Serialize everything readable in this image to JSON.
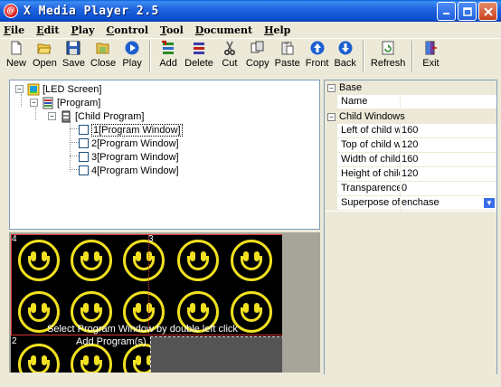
{
  "window": {
    "title": "X Media Player 2.5",
    "icon_letter": "@"
  },
  "menu": [
    {
      "label": "File",
      "u": "F",
      "rest": "ile"
    },
    {
      "label": "Edit",
      "u": "E",
      "rest": "dit"
    },
    {
      "label": "Play",
      "u": "P",
      "rest": "lay"
    },
    {
      "label": "Control",
      "u": "C",
      "rest": "ontrol"
    },
    {
      "label": "Tool",
      "u": "T",
      "rest": "ool"
    },
    {
      "label": "Document",
      "u": "D",
      "rest": "ocument"
    },
    {
      "label": "Help",
      "u": "H",
      "rest": "elp"
    }
  ],
  "toolbar": {
    "new": "New",
    "open": "Open",
    "save": "Save",
    "close": "Close",
    "play": "Play",
    "add": "Add",
    "delete": "Delete",
    "cut": "Cut",
    "copy": "Copy",
    "paste": "Paste",
    "front": "Front",
    "back": "Back",
    "refresh": "Refresh",
    "exit": "Exit"
  },
  "tree": {
    "root": "[LED Screen]",
    "program": "[Program]",
    "child": "[Child Program]",
    "windows": [
      "1[Program Window]",
      "2[Program Window]",
      "3[Program Window]",
      "4[Program Window]"
    ]
  },
  "preview": {
    "hint": "Select Program Window by double left click",
    "add_program": "Add Program(s)",
    "corner_4": "4",
    "corner_3": "3",
    "corner_2": "2"
  },
  "properties": {
    "base_label": "Base",
    "name_label": "Name",
    "name_value": "",
    "child_windows_label": "Child Windows",
    "rows": [
      {
        "name": "Left of child wi",
        "value": "160"
      },
      {
        "name": "Top of child wi",
        "value": "120"
      },
      {
        "name": "Width of child v",
        "value": "160"
      },
      {
        "name": "Height of child",
        "value": "120"
      },
      {
        "name": "Transparence",
        "value": "0"
      },
      {
        "name": "Superpose of c",
        "value": "enchase"
      }
    ]
  },
  "colors": {
    "title_blue": "#0a5fd6",
    "led_yellow": "#f0e020",
    "selection_blue": "#3a6ee8"
  }
}
